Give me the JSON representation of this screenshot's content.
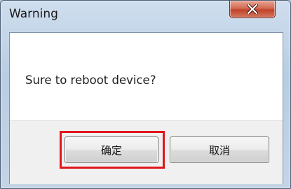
{
  "window": {
    "title": "Warning"
  },
  "titlebar": {
    "close_icon": "close-x-icon"
  },
  "dialog": {
    "message": "Sure to reboot device?",
    "ok_label": "确定",
    "cancel_label": "取消"
  },
  "colors": {
    "highlight": "#e1161b",
    "close_button": "#c0432a"
  }
}
